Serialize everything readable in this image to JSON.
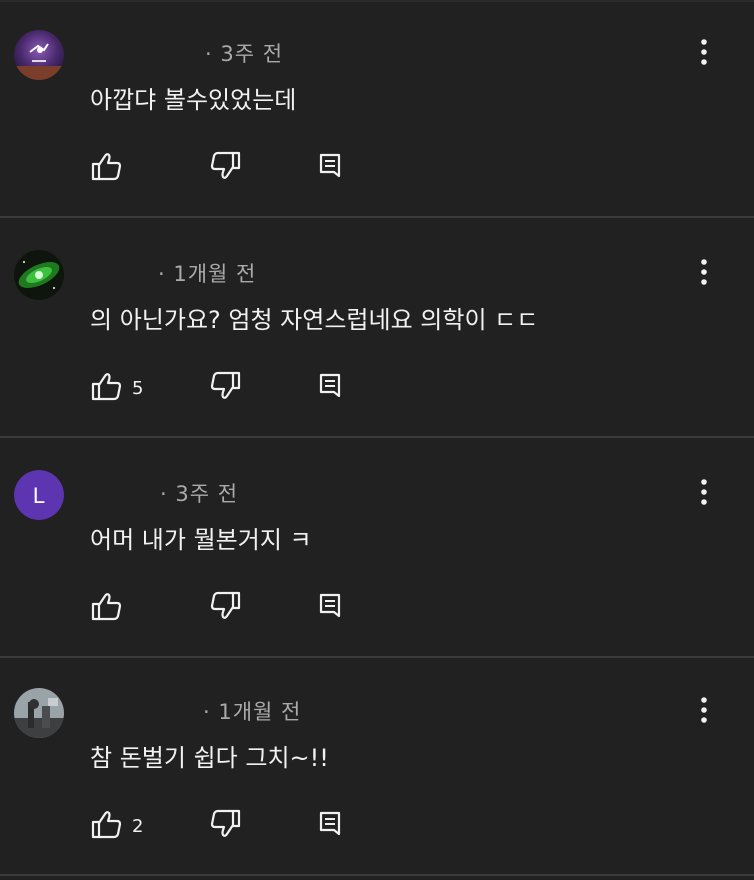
{
  "comments": [
    {
      "time": "· 3주 전",
      "text": "아깝댜 볼수있었는데",
      "likes": "",
      "avatar": "galaxy-purple-avatar"
    },
    {
      "time": "· 1개월 전",
      "text": "의 아닌가요?  엄청 자연스럽네요 의학이 ㄷㄷ",
      "likes": "5",
      "avatar": "green-galaxy-avatar"
    },
    {
      "time": "· 3주 전",
      "text": "어머 내가 뭘본거지 ㅋ",
      "likes": "",
      "avatar": "letter-avatar",
      "avatar_letter": "L",
      "avatar_color": "#5e35b1"
    },
    {
      "time": "· 1개월 전",
      "text": "참 돈벌기 쉽다 그치~!!",
      "likes": "2",
      "avatar": "photo-avatar"
    }
  ],
  "icons": {
    "like": "thumbs-up-icon",
    "dislike": "thumbs-down-icon",
    "reply": "reply-icon",
    "more": "more-vertical-icon"
  },
  "colors": {
    "background": "#212121",
    "text": "#f1f1f1",
    "meta": "#aaaaaa",
    "divider": "#3a3a3a"
  }
}
